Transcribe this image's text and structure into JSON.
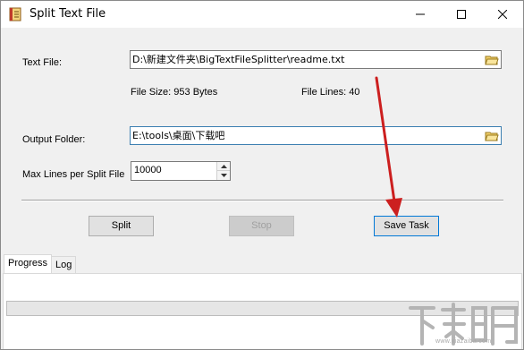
{
  "window": {
    "title": "Split Text File",
    "icon": "notebook-icon"
  },
  "form": {
    "text_file_label": "Text File:",
    "text_file_value": "D:\\新建文件夹\\BigTextFileSplitter\\readme.txt",
    "file_size": "File Size: 953 Bytes",
    "file_lines": "File Lines: 40",
    "output_folder_label": "Output Folder:",
    "output_folder_value": "E:\\tools\\桌面\\下载吧",
    "max_lines_label": "Max Lines per Split File",
    "max_lines_value": "10000"
  },
  "buttons": {
    "split": "Split",
    "stop": "Stop",
    "save_task": "Save Task"
  },
  "tabs": [
    {
      "label": "Progress",
      "selected": true
    },
    {
      "label": "Log",
      "selected": false
    }
  ],
  "progress": {
    "value": 0
  },
  "watermark": {
    "url": "www.xiazaiba.com"
  },
  "colors": {
    "annotation_arrow": "#cc1f1f",
    "focus_border": "#3c7fb1"
  }
}
